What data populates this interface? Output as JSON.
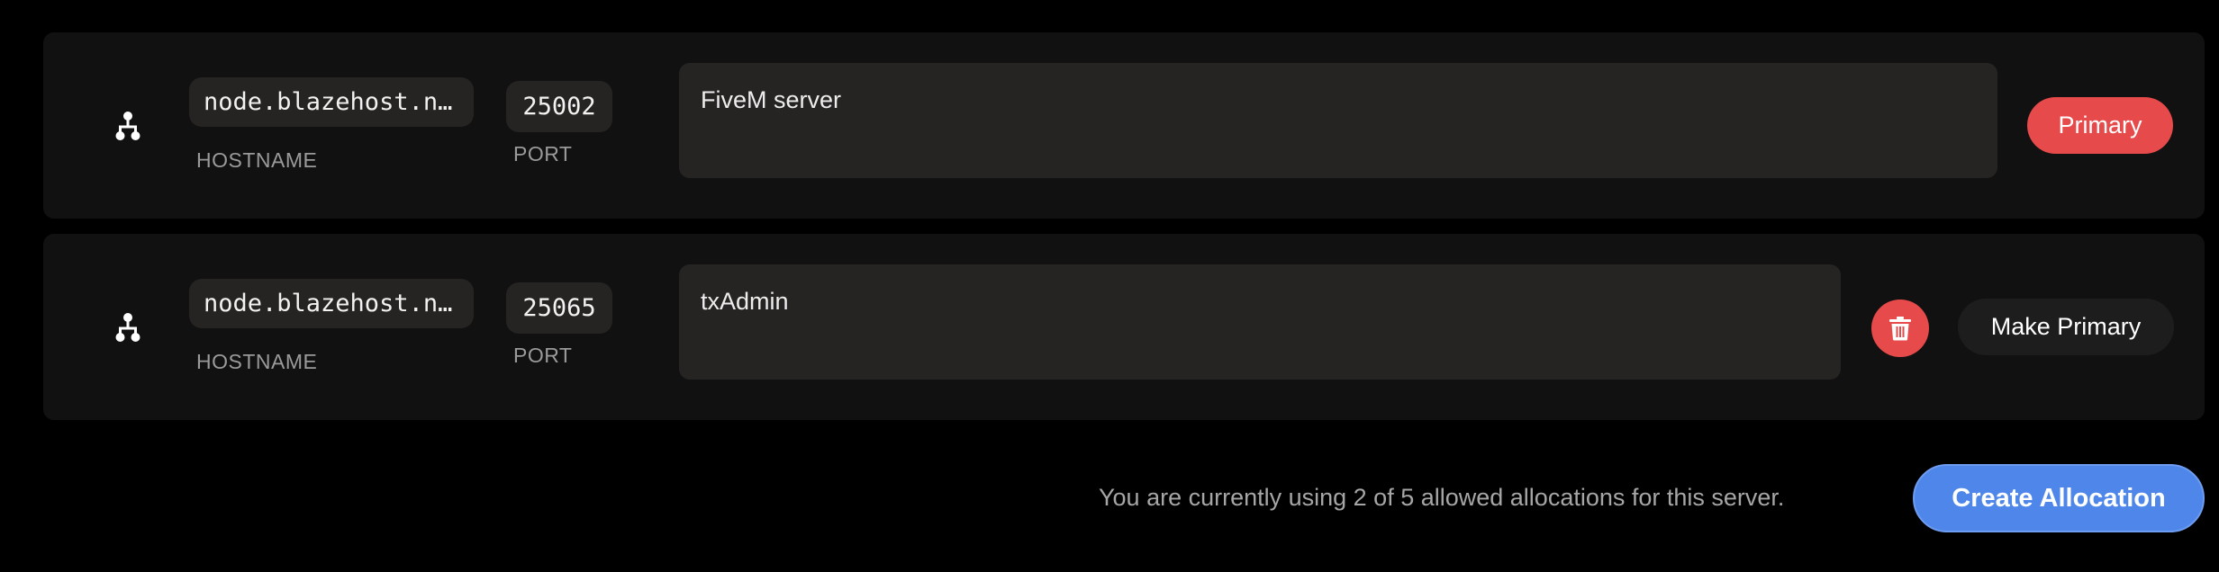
{
  "allocations": [
    {
      "hostname": "node.blazehost.net",
      "hostname_label": "HOSTNAME",
      "port": "25002",
      "port_label": "PORT",
      "notes": "FiveM server",
      "status_label": "Primary",
      "is_primary": true
    },
    {
      "hostname": "node.blazehost.net",
      "hostname_label": "HOSTNAME",
      "port": "25065",
      "port_label": "PORT",
      "notes": "txAdmin",
      "action_label": "Make Primary",
      "is_primary": false
    }
  ],
  "footer": {
    "usage_text": "You are currently using 2 of 5 allowed allocations for this server.",
    "create_label": "Create Allocation"
  },
  "icons": {
    "network": "network-icon",
    "delete": "trash-icon"
  },
  "colors": {
    "background": "#000000",
    "row_background": "#121111",
    "field_background": "#262423",
    "danger": "#e74a4a",
    "accent": "#4e86ea",
    "label": "#9a9a9a"
  }
}
